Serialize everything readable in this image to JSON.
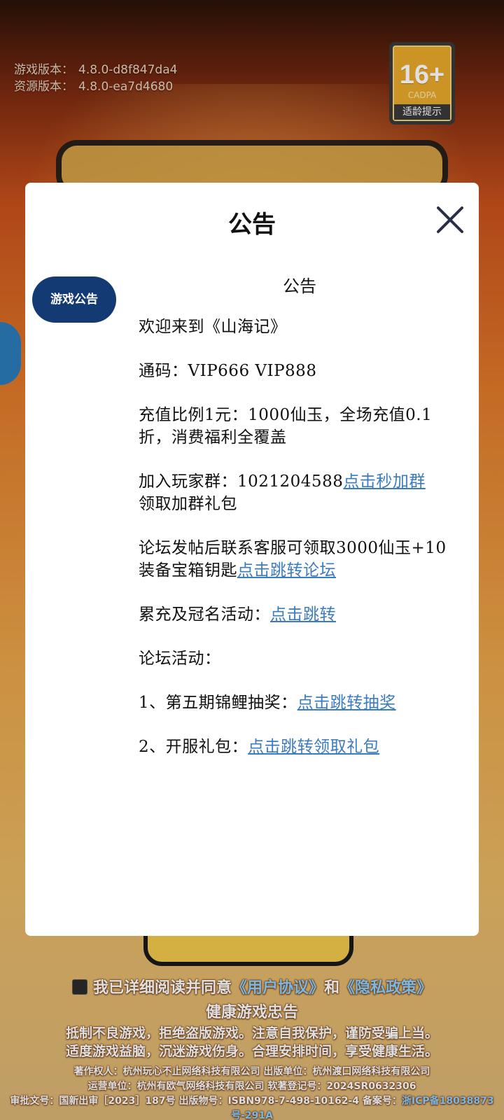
{
  "version": {
    "game_label": "游戏版本：",
    "game_value": "4.8.0-d8f847da4",
    "res_label": "资源版本：",
    "res_value": "4.8.0-ea7d4680"
  },
  "age_badge": {
    "age": "16+",
    "org": "CADPA",
    "tip": "适龄提示"
  },
  "modal": {
    "title": "公告",
    "tab_label": "游戏公告",
    "content_title": "公告",
    "welcome": "欢迎来到《山海记》",
    "codes": "通码：VIP666 VIP888",
    "recharge": "充值比例1元：1000仙玉，全场充值0.1折，消费福利全覆盖",
    "group_text": "加入玩家群：1021204588",
    "group_link": "点击秒加群",
    "group_tail": "领取加群礼包",
    "forum_text": "论坛发帖后联系客服可领取3000仙玉+10装备宝箱钥匙",
    "forum_link": "点击跳转论坛",
    "activity_text": "累充及冠名活动：",
    "activity_link": "点击跳转",
    "forum_activity": "论坛活动：",
    "item1_text": "1、第五期锦鲤抽奖：",
    "item1_link": "点击跳转抽奖",
    "item2_text": "2、开服礼包：",
    "item2_link": "点击跳转领取礼包"
  },
  "footer": {
    "agree_prefix": "我已详细阅读并同意",
    "user_agreement": "《用户协议》",
    "and": "和",
    "privacy_policy": "《隐私政策》",
    "health_title": "健康游戏忠告",
    "health_line1": "抵制不良游戏，拒绝盗版游戏。注意自我保护，谨防受骗上当。",
    "health_line2": "适度游戏益脑，沉迷游戏伤身。合理安排时间，享受健康生活。",
    "copyright": "著作权人：杭州玩心不止网络科技有限公司  出版单位：杭州渡口网络科技有限公司",
    "operator": "运营单位：杭州有欧气网络科技有限公司  软著登记号：2024SR0632306",
    "approval": "审批文号：国新出审［2023］187号 出版物号：ISBN978-7-498-10162-4 备案号：",
    "icp": "浙ICP备18038873号-291A"
  }
}
